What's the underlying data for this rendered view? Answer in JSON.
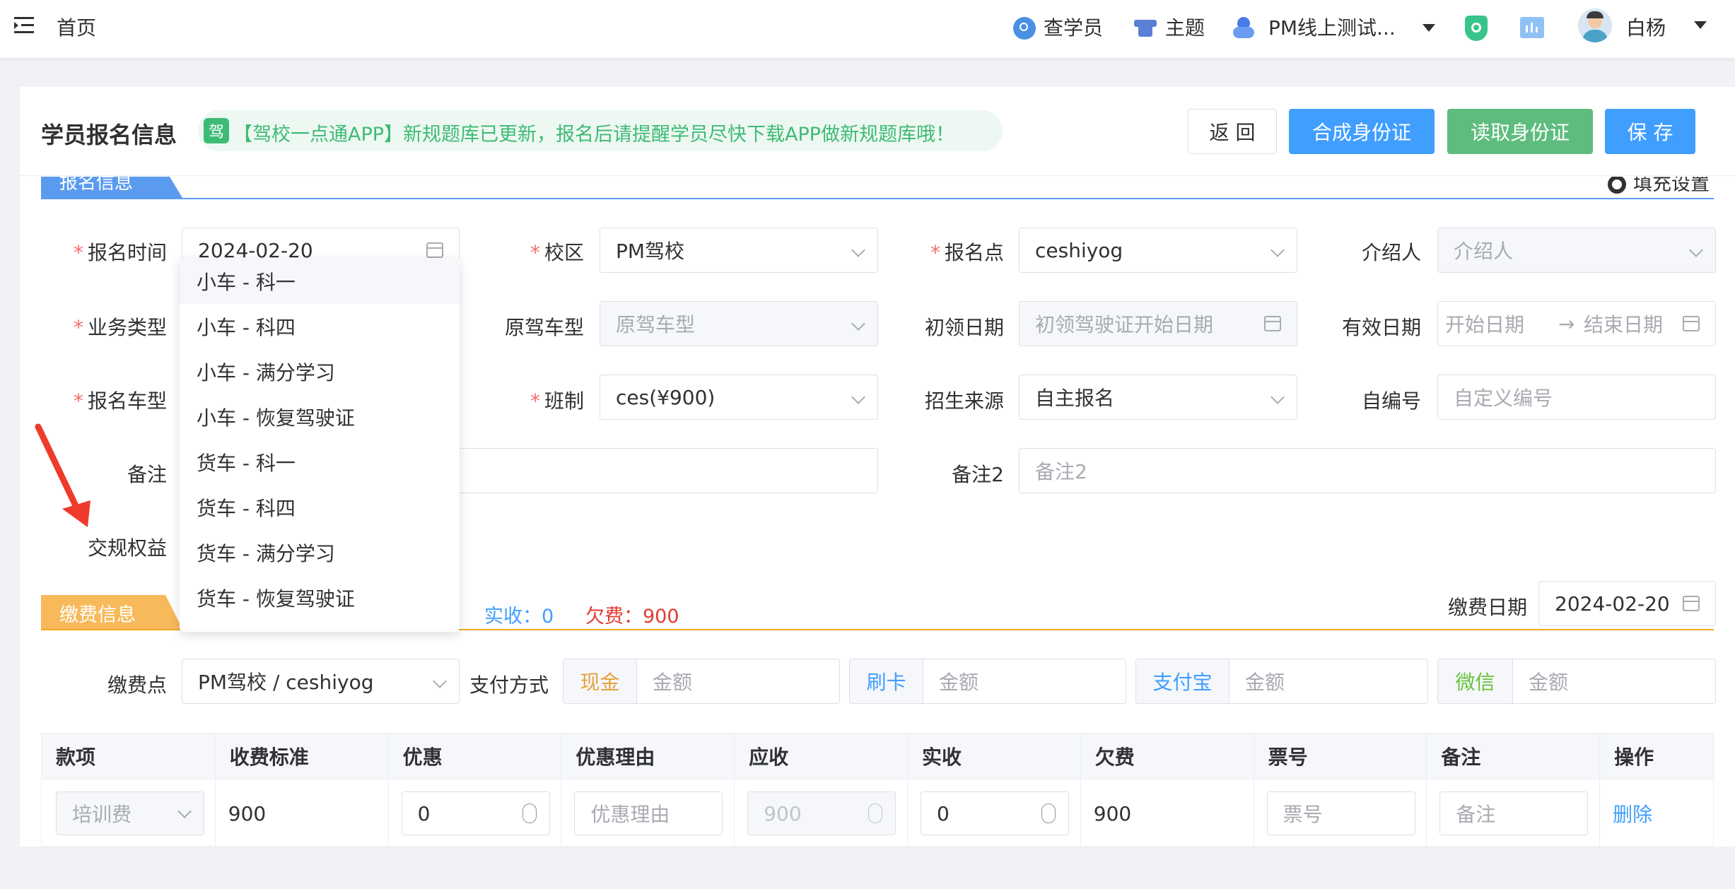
{
  "topbar": {
    "home": "首页",
    "search_student": "查学员",
    "theme": "主题",
    "org": "PM线上测试...",
    "user": "白杨"
  },
  "header": {
    "title": "学员报名信息",
    "notice_badge": "驾",
    "notice": "【驾校一点通APP】新规题库已更新，报名后请提醒学员尽快下载APP做新规题库哦！",
    "btn_back": "返 回",
    "btn_compose_id": "合成身份证",
    "btn_read_id": "读取身份证",
    "btn_save": "保 存"
  },
  "signup": {
    "section": "报名信息",
    "fill_settings": "填充设置",
    "f_time_label": "报名时间",
    "f_time_value": "2024-02-20",
    "f_campus_label": "校区",
    "f_campus_value": "PM驾校",
    "f_point_label": "报名点",
    "f_point_value": "ceshiyog",
    "f_referrer_label": "介绍人",
    "f_referrer_ph": "介绍人",
    "f_biz_label": "业务类型",
    "f_orig_label": "原驾车型",
    "f_orig_ph": "原驾车型",
    "f_first_label": "初领日期",
    "f_first_ph": "初领驾驶证开始日期",
    "f_valid_label": "有效日期",
    "f_valid_start": "开始日期",
    "f_valid_arrow": "→",
    "f_valid_end": "结束日期",
    "f_car_label": "报名车型",
    "f_class_label": "班制",
    "f_class_value": "ces(¥900)",
    "f_source_label": "招生来源",
    "f_source_value": "自主报名",
    "f_no_label": "自编号",
    "f_no_ph": "自定义编号",
    "f_note_label": "备注",
    "f_note2_label": "备注2",
    "f_note2_ph": "备注2",
    "f_rights_label": "交规权益"
  },
  "dropdown": {
    "items": [
      "小车 - 科一",
      "小车 - 科四",
      "小车 - 满分学习",
      "小车 - 恢复驾驶证",
      "货车 - 科一",
      "货车 - 科四",
      "货车 - 满分学习",
      "货车 - 恢复驾驶证"
    ]
  },
  "payment": {
    "section": "缴费信息",
    "received_label": "实收：",
    "received_value": "0",
    "owed_label": "欠费：",
    "owed_value": "900",
    "date_label": "缴费日期",
    "date_value": "2024-02-20",
    "point_label": "缴费点",
    "point_value": "PM驾校 / ceshiyog",
    "method_label": "支付方式",
    "cash": "现金",
    "card": "刷卡",
    "alipay": "支付宝",
    "wechat": "微信",
    "amount_ph": "金额"
  },
  "table": {
    "headers": [
      "款项",
      "收费标准",
      "优惠",
      "优惠理由",
      "应收",
      "实收",
      "欠费",
      "票号",
      "备注",
      "操作"
    ],
    "row": {
      "item": "培训费",
      "standard": "900",
      "discount": "0",
      "reason_ph": "优惠理由",
      "due": "900",
      "received": "0",
      "owed": "900",
      "ticket_ph": "票号",
      "note_ph": "备注",
      "action": "删除"
    }
  },
  "colors": {
    "primary": "#409eff",
    "success": "#67c23a",
    "danger": "#f56c6c",
    "orange": "#f5a623",
    "blue_tab": "#5b9bef"
  }
}
